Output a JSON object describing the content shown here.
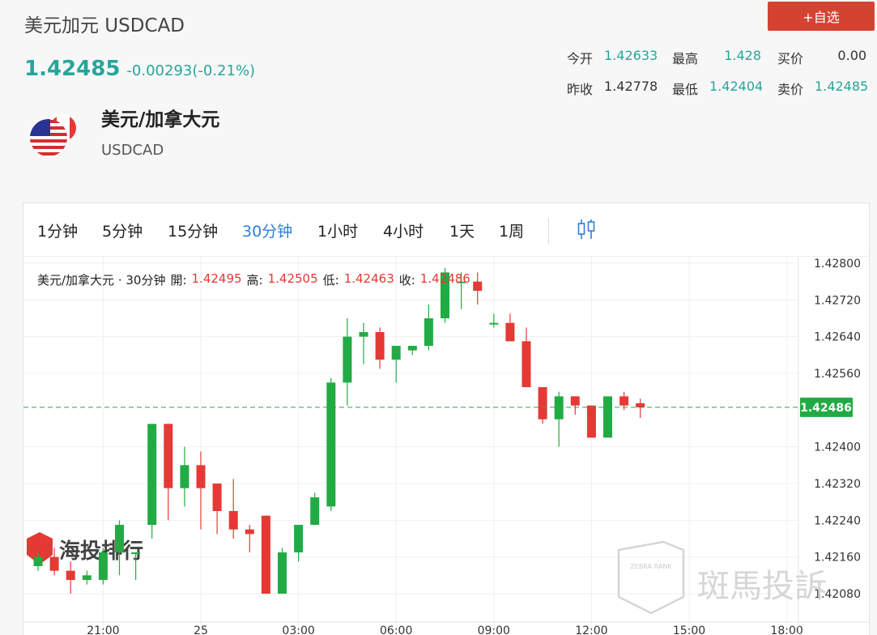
{
  "header": {
    "title": "美元加元 USDCAD",
    "price": "1.42485",
    "change": "-0.00293(-0.21%)"
  },
  "add_button": "+自选",
  "stats": [
    [
      {
        "label": "今开",
        "value": "1.42633",
        "color": "green"
      },
      {
        "label": "最高",
        "value": "1.428",
        "color": "green"
      },
      {
        "label": "买价",
        "value": "0.00",
        "color": "dark"
      }
    ],
    [
      {
        "label": "昨收",
        "value": "1.42778",
        "color": "dark"
      },
      {
        "label": "最低",
        "value": "1.42404",
        "color": "green"
      },
      {
        "label": "卖价",
        "value": "1.42485",
        "color": "green"
      }
    ]
  ],
  "pair": {
    "name": "美元/加拿大元",
    "code": "USDCAD",
    "flag_icon": "us-ca-flag-icon"
  },
  "tabs": [
    "1分钟",
    "5分钟",
    "15分钟",
    "30分钟",
    "1小时",
    "4小时",
    "1天",
    "1周"
  ],
  "active_tab": 3,
  "legend": {
    "name": "美元/加拿大元 · 30分钟",
    "open_label": "開:",
    "open": "1.42495",
    "high_label": "高:",
    "high": "1.42505",
    "low_label": "低:",
    "low": "1.42463",
    "close_label": "收:",
    "close": "1.42486"
  },
  "colors": {
    "up": "#22ab44",
    "down": "#e53935",
    "accent": "#2e7fd8",
    "price": "#26a69a",
    "button": "#d44332"
  },
  "watermarks": {
    "left": "海投排行",
    "right": "斑馬投訴",
    "right_badge": "ZEBRA RANK"
  },
  "chart_data": {
    "type": "candlestick",
    "y_ticks": [
      "1.42800",
      "1.42720",
      "1.42640",
      "1.42560",
      "1.42400",
      "1.42320",
      "1.42240",
      "1.42160",
      "1.42080"
    ],
    "y_range": [
      1.4205,
      1.428
    ],
    "x_ticks": [
      {
        "label": "21:00",
        "i": 4
      },
      {
        "label": "25",
        "i": 10
      },
      {
        "label": "03:00",
        "i": 16
      },
      {
        "label": "06:00",
        "i": 22
      },
      {
        "label": "09:00",
        "i": 28
      },
      {
        "label": "12:00",
        "i": 34
      },
      {
        "label": "15:00",
        "i": 40
      },
      {
        "label": "18:00",
        "i": 46
      }
    ],
    "current_price": "1.42486",
    "current_value": 1.42486,
    "candles": [
      {
        "o": 1.4214,
        "h": 1.4217,
        "l": 1.4213,
        "c": 1.4216
      },
      {
        "o": 1.4216,
        "h": 1.4218,
        "l": 1.4212,
        "c": 1.4213
      },
      {
        "o": 1.4213,
        "h": 1.4215,
        "l": 1.4208,
        "c": 1.4211
      },
      {
        "o": 1.4211,
        "h": 1.4213,
        "l": 1.421,
        "c": 1.4212
      },
      {
        "o": 1.4211,
        "h": 1.4218,
        "l": 1.421,
        "c": 1.4217
      },
      {
        "o": 1.4217,
        "h": 1.4224,
        "l": 1.4212,
        "c": 1.4223
      },
      {
        "o": 1.4217,
        "h": 1.4217,
        "l": 1.4211,
        "c": 1.4217
      },
      {
        "o": 1.4223,
        "h": 1.4245,
        "l": 1.422,
        "c": 1.4245
      },
      {
        "o": 1.4245,
        "h": 1.4245,
        "l": 1.4224,
        "c": 1.4231
      },
      {
        "o": 1.4231,
        "h": 1.424,
        "l": 1.4227,
        "c": 1.4236
      },
      {
        "o": 1.4236,
        "h": 1.4239,
        "l": 1.4222,
        "c": 1.4231
      },
      {
        "o": 1.4232,
        "h": 1.4232,
        "l": 1.4221,
        "c": 1.4226
      },
      {
        "o": 1.4226,
        "h": 1.4233,
        "l": 1.422,
        "c": 1.4222
      },
      {
        "o": 1.4222,
        "h": 1.4223,
        "l": 1.4217,
        "c": 1.4221
      },
      {
        "o": 1.4225,
        "h": 1.4225,
        "l": 1.4208,
        "c": 1.4208
      },
      {
        "o": 1.4208,
        "h": 1.4218,
        "l": 1.4208,
        "c": 1.4217
      },
      {
        "o": 1.4217,
        "h": 1.4223,
        "l": 1.4215,
        "c": 1.4223
      },
      {
        "o": 1.4223,
        "h": 1.423,
        "l": 1.4223,
        "c": 1.4229
      },
      {
        "o": 1.4227,
        "h": 1.4255,
        "l": 1.4226,
        "c": 1.4254
      },
      {
        "o": 1.4254,
        "h": 1.4268,
        "l": 1.4249,
        "c": 1.4264
      },
      {
        "o": 1.4264,
        "h": 1.4267,
        "l": 1.4258,
        "c": 1.4265
      },
      {
        "o": 1.4265,
        "h": 1.4266,
        "l": 1.4257,
        "c": 1.4259
      },
      {
        "o": 1.4259,
        "h": 1.4261,
        "l": 1.4254,
        "c": 1.4262
      },
      {
        "o": 1.4261,
        "h": 1.4262,
        "l": 1.426,
        "c": 1.4262
      },
      {
        "o": 1.4262,
        "h": 1.4271,
        "l": 1.4261,
        "c": 1.4268
      },
      {
        "o": 1.4268,
        "h": 1.4279,
        "l": 1.4267,
        "c": 1.4278
      },
      {
        "o": 1.4276,
        "h": 1.4278,
        "l": 1.427,
        "c": 1.4276
      },
      {
        "o": 1.4276,
        "h": 1.4278,
        "l": 1.4271,
        "c": 1.4274
      },
      {
        "o": 1.4267,
        "h": 1.4269,
        "l": 1.4266,
        "c": 1.4267
      },
      {
        "o": 1.4267,
        "h": 1.4269,
        "l": 1.4263,
        "c": 1.4263
      },
      {
        "o": 1.4263,
        "h": 1.4266,
        "l": 1.4255,
        "c": 1.4253
      },
      {
        "o": 1.4253,
        "h": 1.4253,
        "l": 1.4245,
        "c": 1.4246
      },
      {
        "o": 1.4246,
        "h": 1.4252,
        "l": 1.424,
        "c": 1.4251
      },
      {
        "o": 1.4251,
        "h": 1.4251,
        "l": 1.4247,
        "c": 1.4249
      },
      {
        "o": 1.4249,
        "h": 1.4249,
        "l": 1.4242,
        "c": 1.4242
      },
      {
        "o": 1.4242,
        "h": 1.4251,
        "l": 1.4242,
        "c": 1.4251
      },
      {
        "o": 1.4251,
        "h": 1.4252,
        "l": 1.4248,
        "c": 1.4249
      },
      {
        "o": 1.42495,
        "h": 1.42505,
        "l": 1.42463,
        "c": 1.42486
      }
    ]
  }
}
